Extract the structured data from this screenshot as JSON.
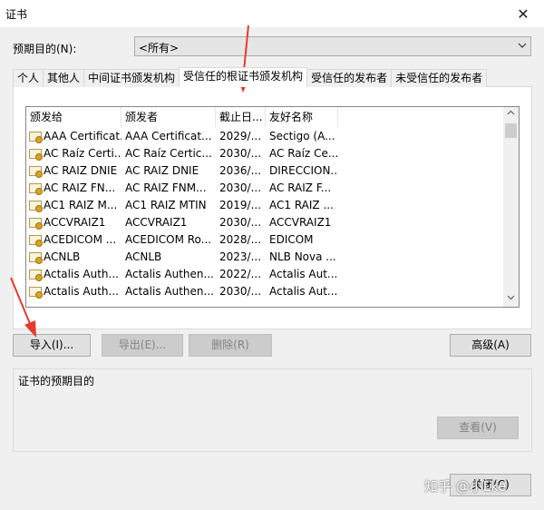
{
  "window": {
    "title": "证书",
    "close_glyph": "✕"
  },
  "purpose": {
    "label": "预期目的(N):",
    "selected": "<所有>"
  },
  "tabs": [
    {
      "label": "个人"
    },
    {
      "label": "其他人"
    },
    {
      "label": "中间证书颁发机构"
    },
    {
      "label": "受信任的根证书颁发机构"
    },
    {
      "label": "受信任的发布者"
    },
    {
      "label": "未受信任的发布者"
    }
  ],
  "list": {
    "columns": [
      "颁发给",
      "颁发者",
      "截止日...",
      "友好名称"
    ],
    "rows": [
      [
        "AAA Certificat...",
        "AAA Certificat...",
        "2029/...",
        "Sectigo (A..."
      ],
      [
        "AC Raíz Certi...",
        "AC Raíz Certic...",
        "2030/...",
        "AC Raíz Ce..."
      ],
      [
        "AC RAIZ DNIE",
        "AC RAIZ DNIE",
        "2036/...",
        "DIRECCION..."
      ],
      [
        "AC RAIZ FN...",
        "AC RAIZ FNM...",
        "2030/...",
        "AC RAIZ F..."
      ],
      [
        "AC1 RAIZ M...",
        "AC1 RAIZ MTIN",
        "2019/...",
        "AC1 RAIZ ..."
      ],
      [
        "ACCVRAIZ1",
        "ACCVRAIZ1",
        "2030/...",
        "ACCVRAIZ1"
      ],
      [
        "ACEDICOM ...",
        "ACEDICOM Ro...",
        "2028/...",
        "EDICOM"
      ],
      [
        "ACNLB",
        "ACNLB",
        "2023/...",
        "NLB Nova ..."
      ],
      [
        "Actalis Auth...",
        "Actalis Authen...",
        "2022/...",
        "Actalis Aut..."
      ],
      [
        "Actalis Auth...",
        "Actalis Authen...",
        "2030/...",
        "Actalis Aut..."
      ]
    ]
  },
  "buttons": {
    "import": "导入(I)...",
    "export": "导出(E)...",
    "remove": "删除(R)",
    "advanced": "高级(A)",
    "view": "查看(V)",
    "close": "关闭(C)"
  },
  "group": {
    "label": "证书的预期目的"
  },
  "watermark": "知乎 @小Lke",
  "colors": {
    "arrow": "#e8392d"
  }
}
